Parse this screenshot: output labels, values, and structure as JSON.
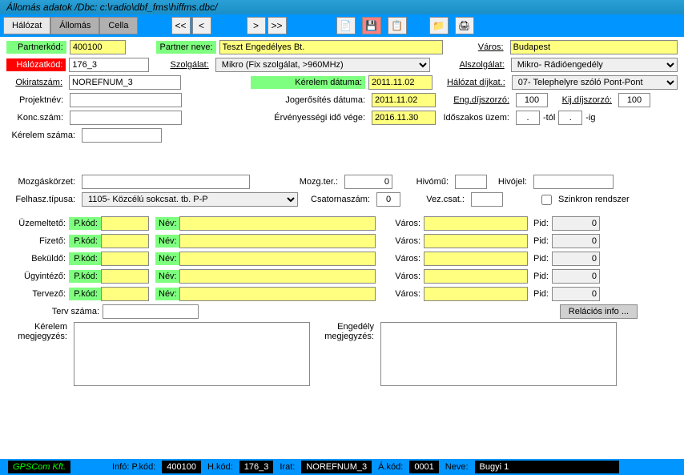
{
  "title": "Állomás adatok    /Dbc: c:\\radio\\dbf_fms\\hiffms.dbc/",
  "tabs": [
    "Hálózat",
    "Állomás",
    "Cella"
  ],
  "nav": {
    "first": "<< ",
    "prev": "<",
    "next": ">",
    "last": " >>"
  },
  "labels": {
    "partnerkod": "Partnerkód:",
    "partnernev": "Partner neve:",
    "varos": "Város:",
    "halozatkod": "Hálózatkód:",
    "szolgalat": "Szolgálat:",
    "alszolgalat": "Alszolgálat:",
    "okiratszam": "Okiratszám:",
    "kerelemdatum": "Kérelem dátuma:",
    "halozatdijkat": "Hálózat díjkat.:",
    "projektnev": "Projektnév:",
    "jogerosites": "Jogerősítés dátuma:",
    "engdij": "Eng.díjszorzó:",
    "kijdij": "Kij.díjszorzó:",
    "koncszam": "Konc.szám:",
    "ervenyesseg": "Érvényességi idő vége:",
    "idoszakos": "Időszakos üzem:",
    "tol": "-tól",
    "ig": "-ig",
    "kerelemszama": "Kérelem száma:",
    "mozgaskorzet": "Mozgáskörzet:",
    "mozgter": "Mozg.ter.:",
    "hivomu": "Hivómű:",
    "hivojel": "Hivójel:",
    "felhasztipusa": "Felhasz.típusa:",
    "csatornaszam": "Csatornaszám:",
    "vezcsat": "Vez.csat.:",
    "szinkron": "Szinkron rendszer",
    "uzemelteto": "Üzemeltető:",
    "fizeto": "Fizető:",
    "bekuldo": "Beküldő:",
    "ugyintezo": "Ügyintéző:",
    "tervezo": "Tervező:",
    "pkod": "P.kód:",
    "nev": "Név:",
    "varos2": "Város:",
    "pid": "Pid:",
    "tervszama": "Terv száma:",
    "relacios": "Relációs info ...",
    "kerelemmeg": "Kérelem megjegyzés:",
    "engedelymeg": "Engedély megjegyzés:"
  },
  "values": {
    "partnerkod": "400100",
    "partnernev": "Teszt Engedélyes Bt.",
    "varos": "Budapest",
    "halozatkod": "176_3",
    "szolgalat": "Mikro (Fix szolgálat, >960MHz)",
    "alszolgalat": "Mikro- Rádióengedély",
    "okiratszam": "NOREFNUM_3",
    "kerelemdatum": "2011.11.02",
    "halozatdijkat": "07- Telephelyre szóló Pont-Pont",
    "jogerosites": "2011.11.02",
    "engdij": "100",
    "kijdij": "100",
    "ervenyesseg": "2016.11.30",
    "idoszakos1": ".",
    "idoszakos2": ".",
    "mozgter": "0",
    "csatornaszam": "0",
    "felhasztipusa": "1105- Közcélú sokcsat. tb. P-P",
    "pid": "0"
  },
  "status": {
    "gps": "GPSCom Kft.",
    "info": "Infó: P.kód:",
    "pkod": "400100",
    "hkod_l": "H.kód:",
    "hkod": "176_3",
    "irat_l": "Irat:",
    "irat": "NOREFNUM_3",
    "akod_l": "Á.kód:",
    "akod": "0001",
    "neve_l": "Neve:",
    "neve": "Bugyi 1"
  }
}
